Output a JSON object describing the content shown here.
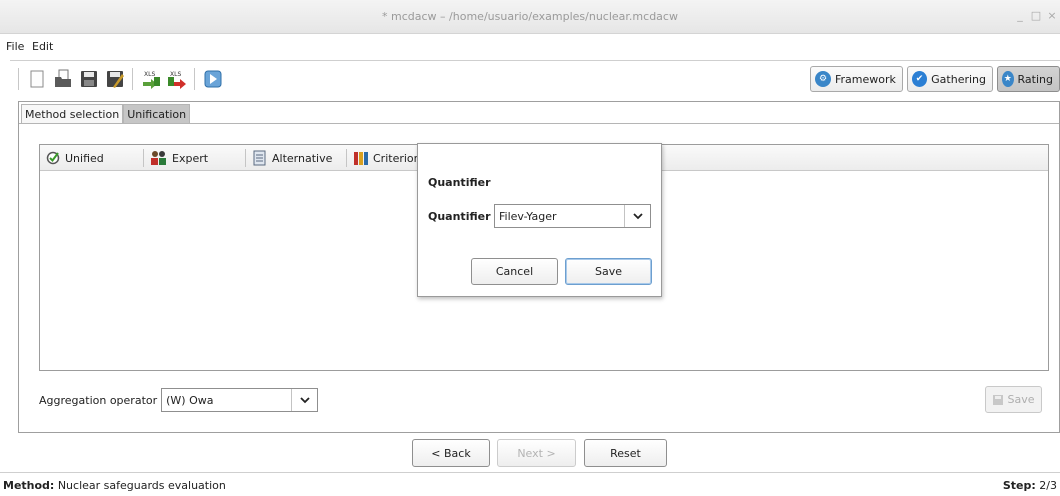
{
  "window": {
    "title": "* mcdacw – /home/usuario/examples/nuclear.mcdacw",
    "minimize_glyph": "_",
    "maximize_glyph": "□",
    "close_glyph": "×"
  },
  "menu": {
    "file": "File",
    "edit": "Edit"
  },
  "toolbar": {
    "icons": [
      "new-document-icon",
      "open-folder-icon",
      "save-disk-icon",
      "save-as-icon",
      "import-xls-icon",
      "export-xls-icon",
      "help-icon"
    ],
    "xls_text": "XLS",
    "modes": [
      {
        "label": "Framework",
        "color": "#3a86c8",
        "glyph": "⚙",
        "active": false
      },
      {
        "label": "Gathering",
        "color": "#2b7fd4",
        "glyph": "✔",
        "active": false
      },
      {
        "label": "Rating",
        "color": "#3a86c8",
        "glyph": "★",
        "active": true
      }
    ]
  },
  "tabs": {
    "method_selection": "Method selection",
    "unification": "Unification"
  },
  "table": {
    "columns": [
      {
        "label": "Unified",
        "icon": "unified-check-icon"
      },
      {
        "label": "Expert",
        "icon": "expert-people-icon"
      },
      {
        "label": "Alternative",
        "icon": "alternative-document-icon"
      },
      {
        "label": "Criterion",
        "icon": "criterion-books-icon"
      }
    ]
  },
  "aggregation": {
    "label": "Aggregation operator",
    "value": "(W) Owa",
    "save_label": "Save"
  },
  "navigation": {
    "back": "< Back",
    "next": "Next >",
    "reset": "Reset"
  },
  "status": {
    "method_label": "Method:",
    "method_value": "Nuclear safeguards evaluation",
    "step_label": "Step:",
    "step_value": "2/3"
  },
  "dialog": {
    "title": "Quantifier",
    "field_label": "Quantifier",
    "field_value": "Filev-Yager",
    "cancel": "Cancel",
    "save": "Save"
  },
  "colors": {
    "accent_blue": "#3a86c8",
    "active_tab": "#c6c6c6"
  }
}
